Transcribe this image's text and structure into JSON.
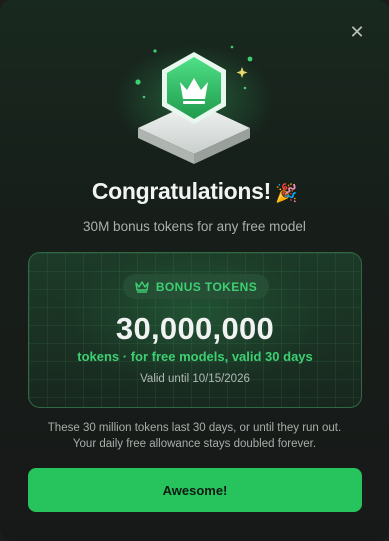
{
  "dialog": {
    "close_icon": "close-icon",
    "hero_icon": "crown-badge-icon",
    "title": "Congratulations!",
    "title_emoji": "🎉",
    "subtitle": "30M bonus tokens for any free model"
  },
  "card": {
    "badge_icon": "crown-icon",
    "badge_label": "BONUS TOKENS",
    "amount": "30,000,000",
    "amount_desc": "tokens · for free models, valid 30 days",
    "valid_until": "Valid until 10/15/2026"
  },
  "note": {
    "line1": "These 30 million tokens last 30 days, or until they run out.",
    "line2": "Your daily free allowance stays doubled forever."
  },
  "actions": {
    "primary_label": "Awesome!"
  },
  "colors": {
    "accent": "#27c35d",
    "accent_text": "#3ecf72",
    "background": "#171918"
  }
}
